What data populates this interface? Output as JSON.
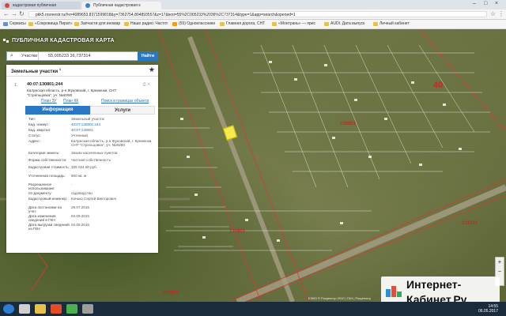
{
  "browser": {
    "tabs": [
      {
        "label": "кадастровая публичная ",
        "active": false
      },
      {
        "label": "Публичная кадастровая к",
        "active": true
      }
    ],
    "url": "pkk5.rosreestr.ru/#x=4089653.8371599818&y=7362754.804893557&z=17&text=55%2C005233%2036%2C737314&type=1&app=search&opened=1",
    "bookmarks": [
      "Сервисы",
      "«Сокровища Пират»",
      "Запчасти для иномар",
      "Наше радио: Частот",
      "(55) Одноклассники",
      "Главная дорога, СНТ",
      "«Монтрань» — прис",
      "AUDI. Дата выпуск",
      "Личный кабинет"
    ]
  },
  "app": {
    "title": "ПУБЛИЧНАЯ КАДАСТРОВАЯ КАРТА",
    "search_type": "Участки",
    "search_value": "55,005233 36,737314",
    "search_button": "Найти"
  },
  "panel": {
    "heading": "Земельные участки",
    "heading_count": "1",
    "item_number": "1.",
    "cad_number": "40:07:130801:244",
    "address": "Калужская область, р-н Жуковский, г. Кременки, СНТ \"Стрельцовка\", уч. №40/80",
    "links": [
      "План ЗУ",
      "План КК",
      "Поиск в границах объекта"
    ],
    "tab_info": "Информация",
    "tab_services": "Услуги",
    "rows": [
      {
        "k": "Тип:",
        "v": "Земельный участок",
        "link": false
      },
      {
        "k": "Кад. номер:",
        "v": "40:07:130801:244",
        "link": true
      },
      {
        "k": "Кад. квартал:",
        "v": "40:07:130801",
        "link": true
      },
      {
        "k": "Статус:",
        "v": "Учтенный",
        "link": false
      },
      {
        "k": "Адрес:",
        "v": "Калужская область, р-н Жуковский, г. Кременки, СНТ \"Стрельцовка\", уч. №40/80",
        "link": false
      },
      {
        "k": "Категория земель:",
        "v": "Земли населенных пунктов",
        "link": false
      },
      {
        "k": "Форма собственности:",
        "v": "Частная собственность",
        "link": false
      },
      {
        "k": "Кадастровая стоимость:",
        "v": "325 024.00 руб.",
        "link": false
      },
      {
        "k": "Уточненная площадь:",
        "v": "800 кв. м",
        "link": false
      },
      {
        "k": "Разрешенное использование:",
        "v": "-",
        "link": false
      },
      {
        "k": "по документу:",
        "v": "садоводство",
        "link": false
      },
      {
        "k": "Кадастровый инженер:",
        "v": "Конько Сергей Викторович",
        "link": false
      },
      {
        "k": "Дата постановки на учет:",
        "v": "29.07.2015",
        "link": false
      },
      {
        "k": "Дата изменения сведений в ГКН:",
        "v": "04.09.2015",
        "link": false
      },
      {
        "k": "Дата выгрузки сведений из ГКН:",
        "v": "04.09.2015",
        "link": false
      }
    ]
  },
  "map": {
    "labels": [
      {
        "text": "40",
        "big": true
      },
      {
        "text": "130801",
        "big": false
      },
      {
        "text": "130801",
        "big": false
      },
      {
        "text": "131101",
        "big": false
      },
      {
        "text": "130801",
        "big": false
      }
    ],
    "attribution": "ЕЭКО © Росреестр 2010 | ГКН | Росреестр"
  },
  "watermark": {
    "line1": "Интернет-",
    "line2": "Кабинет.Ру"
  },
  "taskbar": {
    "time": "14:55",
    "date": "06.05.2017"
  }
}
